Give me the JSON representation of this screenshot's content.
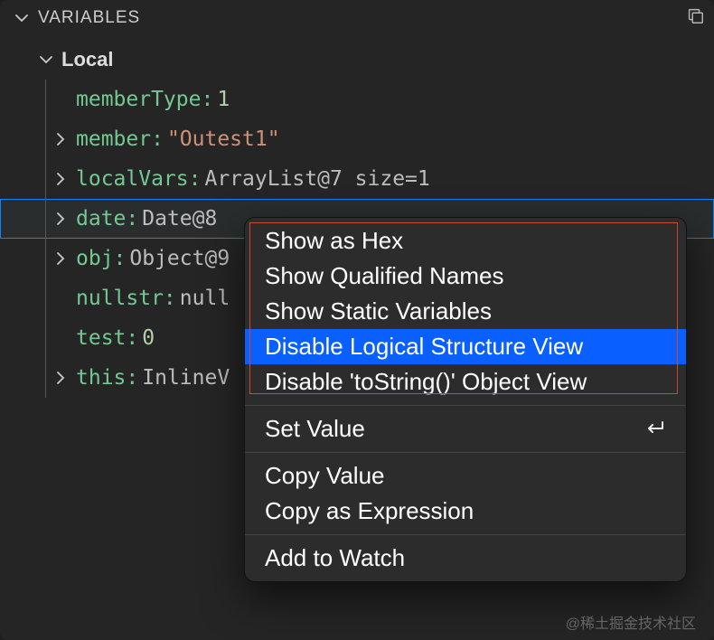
{
  "header": {
    "title": "VARIABLES"
  },
  "scope": {
    "label": "Local"
  },
  "variables": [
    {
      "expandable": false,
      "name": "memberType:",
      "value": "1",
      "valueClass": "num"
    },
    {
      "expandable": true,
      "name": "member:",
      "value": "\"Outest1\"",
      "valueClass": "str"
    },
    {
      "expandable": true,
      "name": "localVars:",
      "value": "ArrayList@7 size=1",
      "valueClass": ""
    },
    {
      "expandable": true,
      "name": "date:",
      "value": "Date@8",
      "valueClass": "",
      "selected": true
    },
    {
      "expandable": true,
      "name": "obj:",
      "value": "Object@9",
      "valueClass": ""
    },
    {
      "expandable": false,
      "name": "nullstr:",
      "value": "null",
      "valueClass": ""
    },
    {
      "expandable": false,
      "name": "test:",
      "value": "0",
      "valueClass": "num"
    },
    {
      "expandable": true,
      "name": "this:",
      "value": "InlineV",
      "valueClass": ""
    }
  ],
  "menu": {
    "groups": [
      [
        {
          "label": "Show as Hex",
          "highlighted": false
        },
        {
          "label": "Show Qualified Names",
          "highlighted": false
        },
        {
          "label": "Show Static Variables",
          "highlighted": false
        },
        {
          "label": "Disable Logical Structure View",
          "highlighted": true
        },
        {
          "label": "Disable 'toString()' Object View",
          "highlighted": false
        }
      ],
      [
        {
          "label": "Set Value",
          "highlighted": false,
          "accel": "enter"
        }
      ],
      [
        {
          "label": "Copy Value",
          "highlighted": false
        },
        {
          "label": "Copy as Expression",
          "highlighted": false
        }
      ],
      [
        {
          "label": "Add to Watch",
          "highlighted": false
        }
      ]
    ]
  },
  "watermark": "@稀土掘金技术社区"
}
